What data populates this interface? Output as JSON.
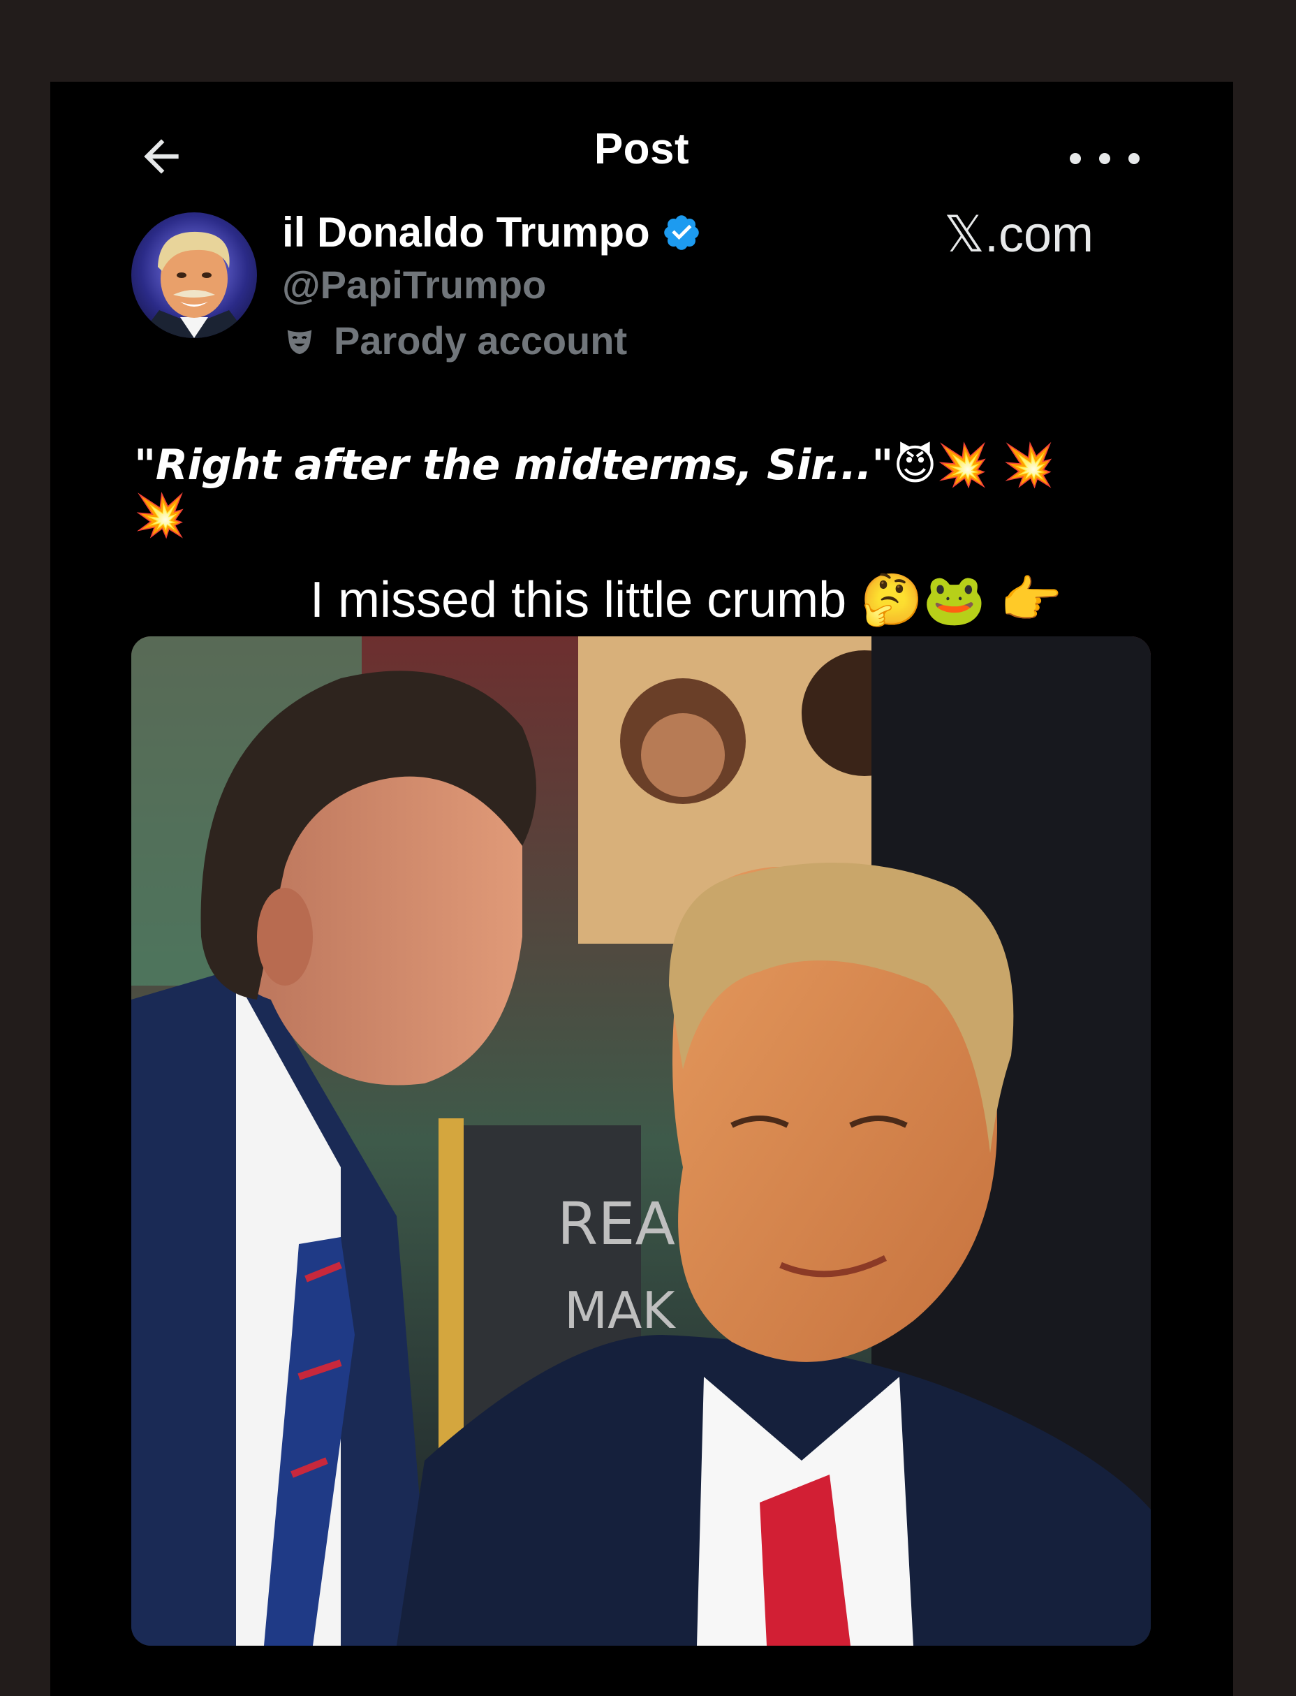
{
  "header": {
    "title": "Post",
    "back_icon": "arrow-left-icon",
    "menu_icon": "more-horizontal-icon"
  },
  "author": {
    "name": "il Donaldo Trumpo",
    "handle": "@PapiTrumpo",
    "badge_icon": "verified-badge-icon",
    "label_icon": "parody-mask-icon",
    "label": "Parody account"
  },
  "source": {
    "domain": "𝕏.com"
  },
  "post": {
    "text": "\"Right after the midterms, Sir...\"",
    "emojis": [
      "😈",
      "💥",
      "💥",
      "💥"
    ]
  },
  "overlay_caption": {
    "text": "I missed this little crumb",
    "emojis": [
      "🤔",
      "🐸",
      "👉"
    ]
  },
  "media": {
    "sign_text_line1": "REA",
    "sign_text_line2": "MAK"
  },
  "colors": {
    "background": "#000000",
    "outer_background": "#221c1b",
    "verified_blue": "#1d9bf0",
    "secondary_text": "#71767b",
    "primary_text": "#ffffff"
  }
}
